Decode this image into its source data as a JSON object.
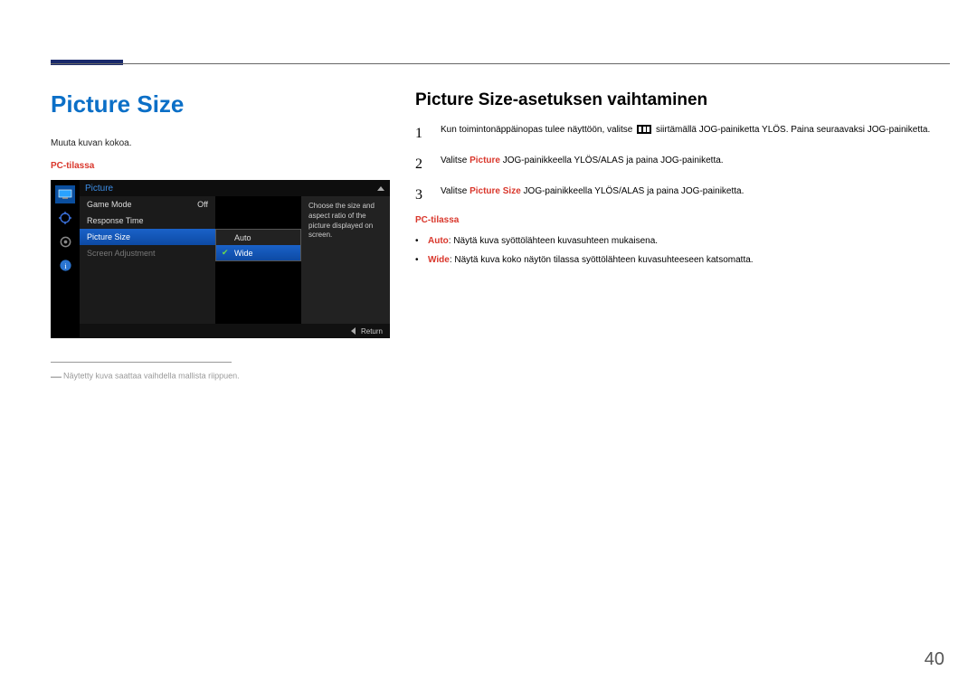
{
  "page_number": "40",
  "left": {
    "title": "Picture Size",
    "intro": "Muuta kuvan kokoa.",
    "mode_label": "PC-tilassa",
    "footnote": "Näytetty kuva saattaa vaihdella mallista riippuen."
  },
  "osd": {
    "header_title": "Picture",
    "rows": {
      "game_mode": {
        "label": "Game Mode",
        "value": "Off"
      },
      "response_time": {
        "label": "Response Time"
      },
      "picture_size": {
        "label": "Picture Size"
      },
      "screen_adjustment": {
        "label": "Screen Adjustment"
      }
    },
    "sublist": {
      "auto": "Auto",
      "wide": "Wide"
    },
    "description": "Choose the size and aspect ratio of the picture displayed on screen.",
    "footer_return": "Return"
  },
  "right": {
    "subtitle": "Picture Size-asetuksen vaihtaminen",
    "steps": {
      "s1": {
        "num": "1",
        "pre": "Kun toimintonäppäinopas tulee näyttöön, valitse ",
        "post": " siirtämällä JOG-painiketta YLÖS. Paina seuraavaksi JOG-painiketta."
      },
      "s2": {
        "num": "2",
        "pre": "Valitse ",
        "kw": "Picture",
        "post": " JOG-painikkeella YLÖS/ALAS ja paina JOG-painiketta."
      },
      "s3": {
        "num": "3",
        "pre": "Valitse ",
        "kw": "Picture Size",
        "post": " JOG-painikkeella YLÖS/ALAS ja paina JOG-painiketta."
      }
    },
    "mode_label": "PC-tilassa",
    "bullets": {
      "auto": {
        "kw": "Auto",
        "text": ": Näytä kuva syöttölähteen kuvasuhteen mukaisena."
      },
      "wide": {
        "kw": "Wide",
        "text": ": Näytä kuva koko näytön tilassa syöttölähteen kuvasuhteeseen katsomatta."
      }
    }
  }
}
